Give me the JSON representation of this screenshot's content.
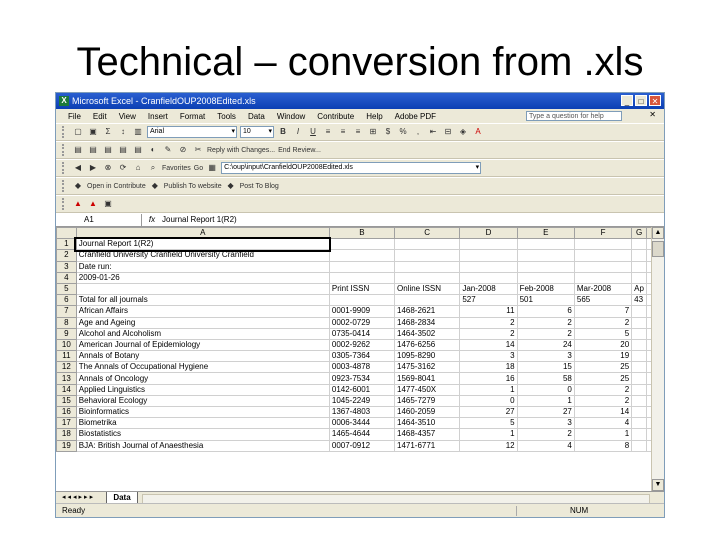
{
  "slide": {
    "title": "Technical – conversion from .xls"
  },
  "window": {
    "title": "Microsoft Excel - CranfieldOUP2008Edited.xls",
    "help_placeholder": "Type a question for help"
  },
  "menu": [
    "File",
    "Edit",
    "View",
    "Insert",
    "Format",
    "Tools",
    "Data",
    "Window",
    "Contribute",
    "Help",
    "Adobe PDF"
  ],
  "toolbar": {
    "font": "Arial",
    "size": "10",
    "reply_text": "Reply with Changes...",
    "end_review": "End Review...",
    "favorites": "Favorites",
    "go": "Go",
    "path": "C:\\oup\\input\\CranfieldOUP2008Edited.xls",
    "open_contribute": "Open in Contribute",
    "publish": "Publish To website",
    "post_blog": "Post To Blog"
  },
  "formula_bar": {
    "cell": "A1",
    "fx": "fx",
    "formula": "Journal Report 1(R2)"
  },
  "sheet": {
    "columns": [
      "A",
      "B",
      "C",
      "D",
      "E",
      "F",
      "G"
    ],
    "rows": [
      {
        "n": "1",
        "cells": [
          "Journal Report 1(R2)",
          "",
          "",
          "",
          "",
          "",
          ""
        ],
        "bold": true
      },
      {
        "n": "2",
        "cells": [
          "Cranfield University Cranfield University Cranfield",
          "",
          "",
          "",
          "",
          "",
          ""
        ],
        "bold": true
      },
      {
        "n": "3",
        "cells": [
          "Date run:",
          "",
          "",
          "",
          "",
          "",
          ""
        ],
        "bold": true
      },
      {
        "n": "4",
        "cells": [
          "2009-01-26",
          "",
          "",
          "",
          "",
          "",
          ""
        ],
        "bold": true
      },
      {
        "n": "5",
        "cells": [
          "",
          "Print ISSN",
          "Online ISSN",
          "Jan-2008",
          "Feb-2008",
          "Mar-2008",
          "Ap"
        ],
        "bold": true
      },
      {
        "n": "6",
        "cells": [
          "Total for all journals",
          "",
          "",
          "527",
          "501",
          "565",
          "43"
        ],
        "bold": true
      },
      {
        "n": "7",
        "cells": [
          "African Affairs",
          "0001-9909",
          "1468-2621",
          "11",
          "6",
          "7",
          ""
        ]
      },
      {
        "n": "8",
        "cells": [
          "Age and Ageing",
          "0002-0729",
          "1468-2834",
          "2",
          "2",
          "2",
          ""
        ]
      },
      {
        "n": "9",
        "cells": [
          "Alcohol and Alcoholism",
          "0735-0414",
          "1464-3502",
          "2",
          "2",
          "5",
          ""
        ]
      },
      {
        "n": "10",
        "cells": [
          "American Journal of Epidemiology",
          "0002-9262",
          "1476-6256",
          "14",
          "24",
          "20",
          ""
        ]
      },
      {
        "n": "11",
        "cells": [
          "Annals of Botany",
          "0305-7364",
          "1095-8290",
          "3",
          "3",
          "19",
          ""
        ]
      },
      {
        "n": "12",
        "cells": [
          "The Annals of Occupational Hygiene",
          "0003-4878",
          "1475-3162",
          "18",
          "15",
          "25",
          ""
        ]
      },
      {
        "n": "13",
        "cells": [
          "Annals of Oncology",
          "0923-7534",
          "1569-8041",
          "16",
          "58",
          "25",
          ""
        ]
      },
      {
        "n": "14",
        "cells": [
          "Applied Linguistics",
          "0142-6001",
          "1477-450X",
          "1",
          "0",
          "2",
          ""
        ]
      },
      {
        "n": "15",
        "cells": [
          "Behavioral Ecology",
          "1045-2249",
          "1465-7279",
          "0",
          "1",
          "2",
          ""
        ]
      },
      {
        "n": "16",
        "cells": [
          "Bioinformatics",
          "1367-4803",
          "1460-2059",
          "27",
          "27",
          "14",
          ""
        ]
      },
      {
        "n": "17",
        "cells": [
          "Biometrika",
          "0006-3444",
          "1464-3510",
          "5",
          "3",
          "4",
          ""
        ]
      },
      {
        "n": "18",
        "cells": [
          "Biostatistics",
          "1465-4644",
          "1468-4357",
          "1",
          "2",
          "1",
          ""
        ]
      },
      {
        "n": "19",
        "cells": [
          "BJA: British Journal of Anaesthesia",
          "0007-0912",
          "1471-6771",
          "12",
          "4",
          "8",
          ""
        ]
      }
    ]
  },
  "tabs": {
    "active": "Data",
    "nav": "◂◂◂▸▸▸"
  },
  "status": {
    "ready": "Ready",
    "num": "NUM"
  }
}
